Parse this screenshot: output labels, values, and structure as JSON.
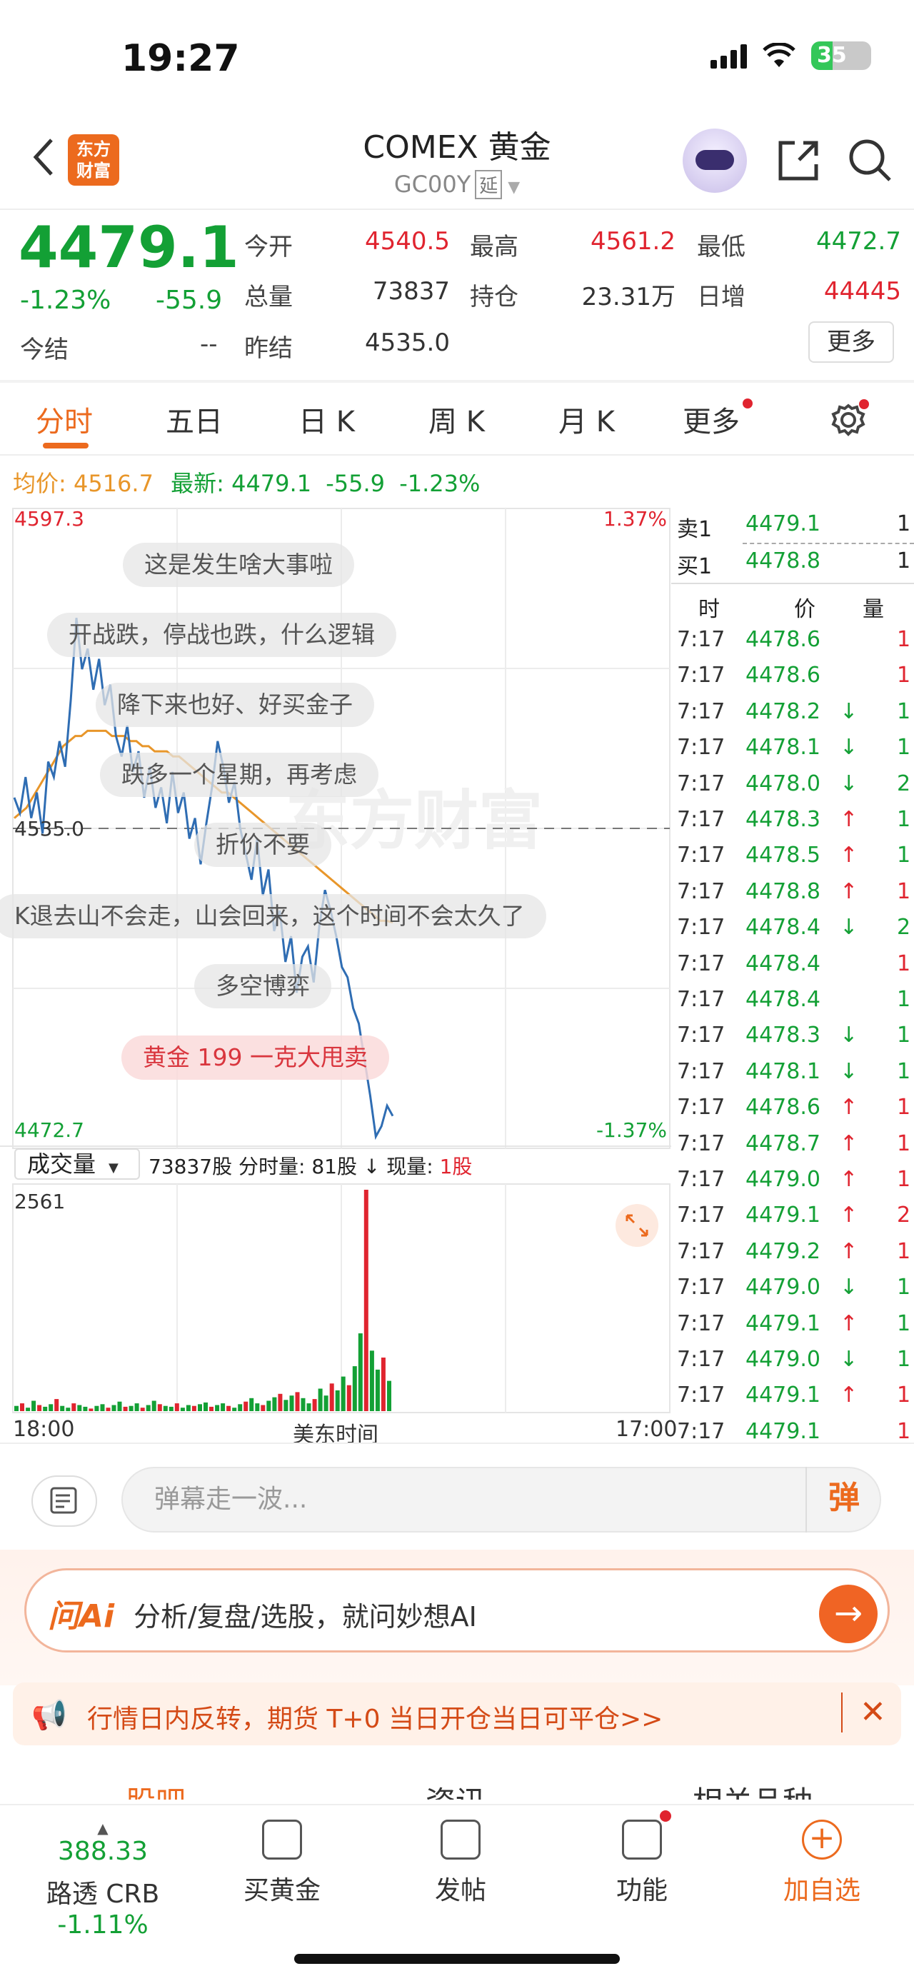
{
  "status_bar": {
    "time": "19:27",
    "battery": "35"
  },
  "header": {
    "logo_line1": "东方",
    "logo_line2": "财富",
    "title": "COMEX 黄金",
    "code": "GC00Y",
    "delay_tag": "延"
  },
  "quote": {
    "last": "4479.1",
    "pct": "-1.23%",
    "change": "-55.9",
    "open_label": "今开",
    "open": "4540.5",
    "high_label": "最高",
    "high": "4561.2",
    "low_label": "最低",
    "low": "4472.7",
    "volume_label": "总量",
    "volume": "73837",
    "oi_label": "持仓",
    "oi": "23.31万",
    "daily_inc_label": "日增",
    "daily_inc": "44445",
    "settle_label": "今结",
    "settle": "--",
    "prev_settle_label": "昨结",
    "prev_settle": "4535.0",
    "more": "更多"
  },
  "tabs": [
    "分时",
    "五日",
    "日 K",
    "周 K",
    "月 K",
    "更多"
  ],
  "avg_row": {
    "avg_label": "均价:",
    "avg": "4516.7",
    "latest_label": "最新:",
    "latest": "4479.1",
    "chg": "-55.9",
    "pct": "-1.23%"
  },
  "chart_data": {
    "type": "line",
    "title": "",
    "ylim": [
      4472.7,
      4597.3
    ],
    "prev_close": 4535.0,
    "y_top_label": "4597.3",
    "y_bottom_label": "4472.7",
    "y_mid_label": "4535.0",
    "pct_top": "1.37%",
    "pct_bottom": "-1.37%",
    "series": [
      {
        "values": [
          4541,
          4538,
          4545,
          4537,
          4542,
          4534,
          4548,
          4545,
          4552,
          4547,
          4560,
          4576,
          4566,
          4570,
          4562,
          4568,
          4559,
          4563,
          4553,
          4549,
          4555,
          4546,
          4550,
          4541,
          4547,
          4539,
          4543,
          4536,
          4546,
          4538,
          4542,
          4533,
          4537,
          4528,
          4536,
          4543,
          4552,
          4547,
          4540,
          4544,
          4535,
          4530,
          4525,
          4533,
          4522,
          4527,
          4515,
          4519,
          4509,
          4514,
          4503,
          4510,
          4512,
          4505,
          4516,
          4523,
          4519,
          4514,
          4508,
          4506,
          4500,
          4497,
          4490,
          4483,
          4475,
          4477,
          4481,
          4479
        ]
      },
      {
        "values": [
          4537,
          4538,
          4539,
          4541,
          4543,
          4545,
          4547,
          4549,
          4551,
          4552,
          4553,
          4553,
          4554,
          4554,
          4554,
          4554,
          4553,
          4553,
          4553,
          4552,
          4552,
          4551,
          4551,
          4550,
          4550,
          4550,
          4549,
          4549,
          4548,
          4547,
          4546,
          4545,
          4544,
          4543,
          4542,
          4542,
          4541,
          4540,
          4539,
          4538,
          4537,
          4536,
          4535,
          4534,
          4533,
          4532,
          4531,
          4530,
          4529,
          4528,
          4527,
          4526,
          4525,
          4524,
          4523,
          4522,
          4521,
          4520,
          4519,
          4518,
          4517,
          4517,
          4516.7
        ]
      }
    ]
  },
  "volume": {
    "selector": "成交量",
    "total": "73837股",
    "period_label": "分时量:",
    "period": "81股",
    "now_label": "现量:",
    "now": "1股",
    "ymax": "2561",
    "bars": [
      60,
      90,
      40,
      120,
      70,
      50,
      80,
      140,
      60,
      40,
      90,
      70,
      50,
      30,
      60,
      80,
      40,
      70,
      110,
      50,
      60,
      90,
      40,
      70,
      120,
      80,
      60,
      50,
      90,
      40,
      70,
      60,
      80,
      100,
      50,
      70,
      90,
      60,
      40,
      80,
      110,
      150,
      90,
      70,
      120,
      160,
      200,
      130,
      180,
      220,
      150,
      90,
      140,
      260,
      180,
      320,
      240,
      400,
      300,
      520,
      900,
      2561,
      700,
      480,
      620,
      350
    ]
  },
  "axis": {
    "left": "18:00",
    "mid": "美东时间",
    "right": "17:00"
  },
  "order_book": [
    {
      "label": "卖1",
      "price": "4479.1",
      "qty": "1"
    },
    {
      "label": "买1",
      "price": "4478.8",
      "qty": "1"
    }
  ],
  "trades_header": {
    "time": "时",
    "price": "价",
    "qty": "量"
  },
  "trades": [
    {
      "time": "7:17",
      "price": "4478.6",
      "dir": "",
      "qty": "1",
      "qc": "red"
    },
    {
      "time": "7:17",
      "price": "4478.6",
      "dir": "",
      "qty": "1",
      "qc": "red"
    },
    {
      "time": "7:17",
      "price": "4478.2",
      "dir": "↓",
      "qty": "1",
      "qc": "green"
    },
    {
      "time": "7:17",
      "price": "4478.1",
      "dir": "↓",
      "qty": "1",
      "qc": "green"
    },
    {
      "time": "7:17",
      "price": "4478.0",
      "dir": "↓",
      "qty": "2",
      "qc": "green"
    },
    {
      "time": "7:17",
      "price": "4478.3",
      "dir": "↑",
      "qty": "1",
      "qc": "green"
    },
    {
      "time": "7:17",
      "price": "4478.5",
      "dir": "↑",
      "qty": "1",
      "qc": "green"
    },
    {
      "time": "7:17",
      "price": "4478.8",
      "dir": "↑",
      "qty": "1",
      "qc": "red"
    },
    {
      "time": "7:17",
      "price": "4478.4",
      "dir": "↓",
      "qty": "2",
      "qc": "green"
    },
    {
      "time": "7:17",
      "price": "4478.4",
      "dir": "",
      "qty": "1",
      "qc": "red"
    },
    {
      "time": "7:17",
      "price": "4478.4",
      "dir": "",
      "qty": "1",
      "qc": "green"
    },
    {
      "time": "7:17",
      "price": "4478.3",
      "dir": "↓",
      "qty": "1",
      "qc": "green"
    },
    {
      "time": "7:17",
      "price": "4478.1",
      "dir": "↓",
      "qty": "1",
      "qc": "green"
    },
    {
      "time": "7:17",
      "price": "4478.6",
      "dir": "↑",
      "qty": "1",
      "qc": "red"
    },
    {
      "time": "7:17",
      "price": "4478.7",
      "dir": "↑",
      "qty": "1",
      "qc": "red"
    },
    {
      "time": "7:17",
      "price": "4479.0",
      "dir": "↑",
      "qty": "1",
      "qc": "red"
    },
    {
      "time": "7:17",
      "price": "4479.1",
      "dir": "↑",
      "qty": "2",
      "qc": "red"
    },
    {
      "time": "7:17",
      "price": "4479.2",
      "dir": "↑",
      "qty": "1",
      "qc": "red"
    },
    {
      "time": "7:17",
      "price": "4479.0",
      "dir": "↓",
      "qty": "1",
      "qc": "green"
    },
    {
      "time": "7:17",
      "price": "4479.1",
      "dir": "↑",
      "qty": "1",
      "qc": "green"
    },
    {
      "time": "7:17",
      "price": "4479.0",
      "dir": "↓",
      "qty": "1",
      "qc": "green"
    },
    {
      "time": "7:17",
      "price": "4479.1",
      "dir": "↑",
      "qty": "1",
      "qc": "red"
    },
    {
      "time": "7:17",
      "price": "4479.1",
      "dir": "",
      "qty": "1",
      "qc": "red"
    }
  ],
  "danmaku": [
    "这是发生啥大事啦",
    "开战跌，停战也跌，什么逻辑",
    "降下来也好、好买金子",
    "跌多一个星期，再考虑",
    "折价不要",
    "K退去山不会走，山会回来，这个时间不会太久了",
    "多空博弈",
    "黄金 199 一克大甩卖"
  ],
  "comment": {
    "placeholder": "弹幕走一波...",
    "toggle": "弹"
  },
  "ai": {
    "logo": "问Ai",
    "text": "分析/复盘/选股，就问妙想AI"
  },
  "promo": {
    "text": "行情日内反转，期货 T+0 当日开仓当日可平仓>>"
  },
  "sub_tabs": [
    "股吧",
    "资讯",
    "相关品种"
  ],
  "bottom_nav": {
    "crb_value": "388.33",
    "crb_label": "路透 CRB",
    "crb_pct": "-1.11%",
    "buy_gold": "买黄金",
    "post": "发帖",
    "features": "功能",
    "add_watch": "加自选"
  },
  "colors": {
    "up": "#e0242f",
    "down": "#13a035",
    "accent": "#ec6a1e",
    "price_line": "#2f6db3",
    "avg_line": "#e8962a"
  }
}
